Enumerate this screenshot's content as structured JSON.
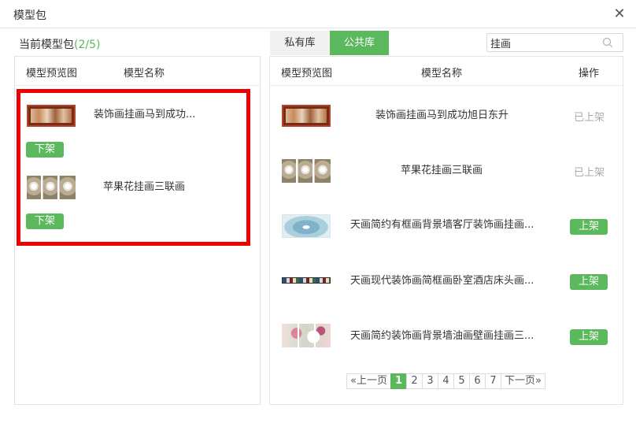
{
  "dialog": {
    "title": "模型包",
    "close_icon": "close-icon"
  },
  "left": {
    "heading": "当前模型包",
    "count": "(2/5)",
    "columns": [
      "模型预览图",
      "模型名称"
    ],
    "items": [
      {
        "name": "装饰画挂画马到成功...",
        "action": "下架"
      },
      {
        "name": "苹果花挂画三联画",
        "action": "下架"
      }
    ]
  },
  "tabs": {
    "private": "私有库",
    "public": "公共库"
  },
  "search": {
    "value": "挂画"
  },
  "right": {
    "columns": [
      "模型预览图",
      "模型名称",
      "操作"
    ],
    "rows": [
      {
        "name": "装饰画挂画马到成功旭日东升",
        "action": "已上架"
      },
      {
        "name": "苹果花挂画三联画",
        "action": "已上架"
      },
      {
        "name": "天画简约有框画背景墙客厅装饰画挂画...",
        "action": "上架"
      },
      {
        "name": "天画现代装饰画简框画卧室酒店床头画...",
        "action": "上架"
      },
      {
        "name": "天画简约装饰画背景墙油画壁画挂画三...",
        "action": "上架"
      }
    ]
  },
  "pagination": {
    "prev": "«上一页",
    "pages": [
      "1",
      "2",
      "3",
      "4",
      "5",
      "6",
      "7"
    ],
    "next": "下一页»",
    "current": "1"
  },
  "colors": {
    "accent": "#5cb85c",
    "highlight": "#ee0000",
    "muted": "#aaaaaa"
  }
}
